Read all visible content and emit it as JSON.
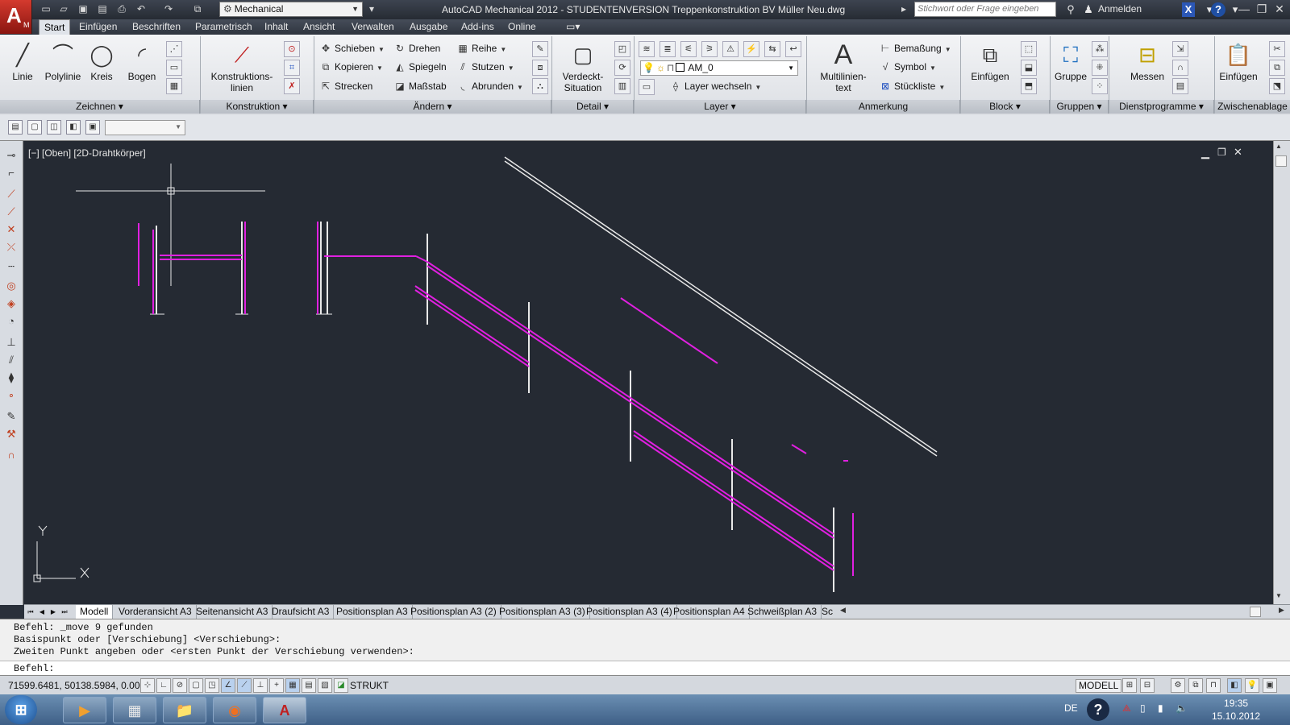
{
  "title_bar": {
    "title": "AutoCAD Mechanical 2012 - STUDENTENVERSION    Treppenkonstruktion BV Müller Neu.dwg",
    "workspace": "Mechanical",
    "search_placeholder": "Stichwort oder Frage eingeben",
    "login": "Anmelden"
  },
  "ribbon_tabs": [
    "Start",
    "Einfügen",
    "Beschriften",
    "Parametrisch",
    "Inhalt",
    "Ansicht",
    "Verwalten",
    "Ausgabe",
    "Add-ins",
    "Online"
  ],
  "panels": {
    "zeichnen": {
      "title": "Zeichnen",
      "linie": "Linie",
      "polylinie": "Polylinie",
      "kreis": "Kreis",
      "bogen": "Bogen"
    },
    "konstruktion": {
      "title": "Konstruktion",
      "label1": "Konstruktions-",
      "label2": "linien"
    },
    "aendern": {
      "title": "Ändern",
      "schieben": "Schieben",
      "drehen": "Drehen",
      "reihe": "Reihe",
      "kopieren": "Kopieren",
      "spiegeln": "Spiegeln",
      "stutzen": "Stutzen",
      "strecken": "Strecken",
      "massstab": "Maßstab",
      "abrunden": "Abrunden"
    },
    "detail": {
      "title": "Detail",
      "label1": "Verdeckt-",
      "label2": "Situation"
    },
    "layer": {
      "title": "Layer",
      "current": "AM_0",
      "wechseln": "Layer wechseln"
    },
    "anmerkung": {
      "title": "Anmerkung",
      "mtext1": "Multilinien-",
      "mtext2": "text",
      "bemassung": "Bemaßung",
      "symbol": "Symbol",
      "stueckliste": "Stückliste"
    },
    "block": {
      "title": "Block",
      "einfuegen": "Einfügen"
    },
    "gruppen": {
      "title": "Gruppen",
      "gruppe": "Gruppe"
    },
    "dienst": {
      "title": "Dienstprogramme",
      "messen": "Messen"
    },
    "zwischen": {
      "title": "Zwischenablage",
      "einfuegen": "Einfügen"
    }
  },
  "viewport": {
    "label": "[−] [Oben] [2D-Drahtkörper]"
  },
  "layout_tabs": [
    "Modell",
    "Vorderansicht A3",
    "Seitenansicht A3",
    "Draufsicht A3",
    "Positionsplan A3",
    "Positionsplan A3 (2)",
    "Positionsplan A3 (3)",
    "Positionsplan A3 (4)",
    "Positionsplan A4",
    "Schweißplan A3",
    "Sc"
  ],
  "command": {
    "history": [
      "Befehl: _move 9 gefunden",
      "Basispunkt oder [Verschiebung] <Verschiebung>:",
      "Zweiten Punkt angeben oder <ersten Punkt der Verschiebung verwenden>:"
    ],
    "prompt": "Befehl:"
  },
  "status": {
    "coords": "71599.6481, 50138.5984, 0.0000",
    "strukt": "STRUKT",
    "modell": "MODELL"
  },
  "taskbar": {
    "lang": "DE",
    "time": "19:35",
    "date": "15.10.2012"
  },
  "colors": {
    "drawing_bg": "#252a33",
    "magenta": "#e020e0",
    "white": "#ffffff"
  }
}
